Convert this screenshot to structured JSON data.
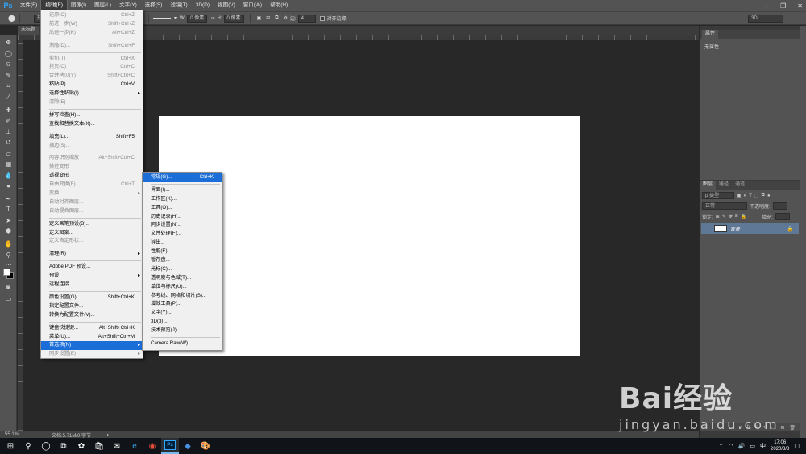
{
  "menubar": {
    "logo": "Ps",
    "items": [
      "文件(F)",
      "编辑(E)",
      "图像(I)",
      "图层(L)",
      "文字(Y)",
      "选择(S)",
      "滤镜(T)",
      "3D(D)",
      "视图(V)",
      "窗口(W)",
      "帮助(H)"
    ],
    "active_index": 1
  },
  "options": {
    "shape_mode": "形状",
    "w_label": "W:",
    "w_value": "0 像素",
    "h_label": "H:",
    "h_value": "0 像素",
    "edge_label": "边:",
    "edge_value": "4",
    "align_edges": "对齐边缘",
    "workspace": "3D"
  },
  "document": {
    "tab_label": "未标题"
  },
  "statusbar": {
    "zoom": "55.1%",
    "doc_info": "文档:5.71M/0 字节"
  },
  "edit_menu": {
    "groups": [
      [
        {
          "label": "还原(O)",
          "shortcut": "Ctrl+Z",
          "disabled": true
        },
        {
          "label": "前进一步(W)",
          "shortcut": "Shift+Ctrl+Z",
          "disabled": true
        },
        {
          "label": "后退一步(K)",
          "shortcut": "Alt+Ctrl+Z",
          "disabled": true
        }
      ],
      [
        {
          "label": "渐隐(D)...",
          "shortcut": "Shift+Ctrl+F",
          "disabled": true
        }
      ],
      [
        {
          "label": "剪切(T)",
          "shortcut": "Ctrl+X",
          "disabled": true
        },
        {
          "label": "拷贝(C)",
          "shortcut": "Ctrl+C",
          "disabled": true
        },
        {
          "label": "合并拷贝(Y)",
          "shortcut": "Shift+Ctrl+C",
          "disabled": true
        },
        {
          "label": "粘贴(P)",
          "shortcut": "Ctrl+V",
          "disabled": false
        },
        {
          "label": "选择性粘贴(I)",
          "shortcut": "",
          "disabled": false,
          "submenu": true
        },
        {
          "label": "清除(E)",
          "shortcut": "",
          "disabled": true
        }
      ],
      [
        {
          "label": "拼写检查(H)...",
          "shortcut": "",
          "disabled": false
        },
        {
          "label": "查找和替换文本(X)...",
          "shortcut": "",
          "disabled": false
        }
      ],
      [
        {
          "label": "填充(L)...",
          "shortcut": "Shift+F5",
          "disabled": false
        },
        {
          "label": "描边(S)...",
          "shortcut": "",
          "disabled": true
        }
      ],
      [
        {
          "label": "内容识别缩放",
          "shortcut": "Alt+Shift+Ctrl+C",
          "disabled": true
        },
        {
          "label": "操控变形",
          "shortcut": "",
          "disabled": true
        },
        {
          "label": "透视变形",
          "shortcut": "",
          "disabled": false
        },
        {
          "label": "自由变换(F)",
          "shortcut": "Ctrl+T",
          "disabled": true
        },
        {
          "label": "变换",
          "shortcut": "",
          "disabled": true,
          "submenu": true
        },
        {
          "label": "自动对齐图层...",
          "shortcut": "",
          "disabled": true
        },
        {
          "label": "自动混合图层...",
          "shortcut": "",
          "disabled": true
        }
      ],
      [
        {
          "label": "定义画笔预设(B)...",
          "shortcut": "",
          "disabled": false
        },
        {
          "label": "定义图案...",
          "shortcut": "",
          "disabled": false
        },
        {
          "label": "定义自定形状...",
          "shortcut": "",
          "disabled": true
        }
      ],
      [
        {
          "label": "清理(R)",
          "shortcut": "",
          "disabled": false,
          "submenu": true
        }
      ],
      [
        {
          "label": "Adobe PDF 预设...",
          "shortcut": "",
          "disabled": false
        },
        {
          "label": "预设",
          "shortcut": "",
          "disabled": false,
          "submenu": true
        },
        {
          "label": "远程连接...",
          "shortcut": "",
          "disabled": false
        }
      ],
      [
        {
          "label": "颜色设置(G)...",
          "shortcut": "Shift+Ctrl+K",
          "disabled": false
        },
        {
          "label": "指定配置文件...",
          "shortcut": "",
          "disabled": false
        },
        {
          "label": "转换为配置文件(V)...",
          "shortcut": "",
          "disabled": false
        }
      ],
      [
        {
          "label": "键盘快捷键...",
          "shortcut": "Alt+Shift+Ctrl+K",
          "disabled": false
        },
        {
          "label": "菜单(U)...",
          "shortcut": "Alt+Shift+Ctrl+M",
          "disabled": false
        },
        {
          "label": "首选项(N)",
          "shortcut": "",
          "disabled": false,
          "submenu": true,
          "highlighted": true
        },
        {
          "label": "同步设置(E)",
          "shortcut": "",
          "disabled": true,
          "submenu": true
        }
      ]
    ]
  },
  "pref_menu": {
    "groups": [
      [
        {
          "label": "常规(G)...",
          "shortcut": "Ctrl+K",
          "highlighted": true
        }
      ],
      [
        {
          "label": "界面(I)..."
        },
        {
          "label": "工作区(K)..."
        },
        {
          "label": "工具(O)..."
        },
        {
          "label": "历史记录(H)..."
        },
        {
          "label": "同步设置(N)..."
        },
        {
          "label": "文件处理(F)..."
        },
        {
          "label": "导出..."
        },
        {
          "label": "性能(E)..."
        },
        {
          "label": "暂存盘..."
        },
        {
          "label": "光标(C)..."
        },
        {
          "label": "透明度与色域(T)..."
        },
        {
          "label": "单位与标尺(U)..."
        },
        {
          "label": "参考线、网格和切片(S)..."
        },
        {
          "label": "增效工具(P)..."
        },
        {
          "label": "文字(Y)..."
        },
        {
          "label": "3D(3)..."
        },
        {
          "label": "技术预览(J)..."
        }
      ],
      [
        {
          "label": "Camera Raw(W)..."
        }
      ]
    ]
  },
  "properties": {
    "tab": "属性",
    "empty_text": "无属性"
  },
  "layers": {
    "tabs": [
      "图层",
      "路径",
      "通道"
    ],
    "filter_label": "ρ 类型",
    "blend_mode": "正常",
    "opacity_label": "不透明度:",
    "lock_label": "锁定:",
    "fill_label": "填充:",
    "layer_name": "背景"
  },
  "watermark": {
    "text": "Bai经验",
    "url": "jingyan.baidu.com"
  },
  "taskbar": {
    "time": "17:06",
    "date": "2020/3/8",
    "ime": "中"
  }
}
